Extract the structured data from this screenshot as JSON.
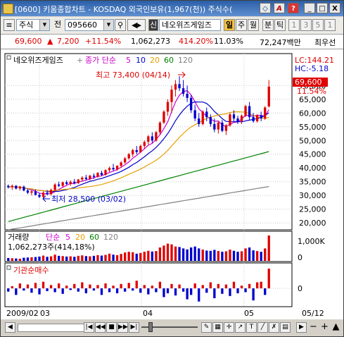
{
  "window": {
    "title": "[0600] 키움종합차트 - KOSDAQ 외국인보유(1,967(천)) 주식수(",
    "buttons": [
      "◇",
      "A",
      "?",
      "_",
      "□",
      "X"
    ]
  },
  "toolbar": {
    "market_type": "주식",
    "prev_label": "전",
    "stock_code": "095660",
    "stock_name": "네오위즈게임즈",
    "period_buttons": [
      "일",
      "주",
      "월",
      "분",
      "틱"
    ],
    "minute_values": [
      "1",
      "3",
      "5",
      "1"
    ]
  },
  "info_row": {
    "price": "69,600",
    "change": "7,200",
    "change_pct": "+11.54%",
    "volume": "1,062,273",
    "volume_ratio": "414.20%",
    "turnover": "11.03%",
    "trade_value": "72,247백만",
    "right_label": "최우선"
  },
  "legend": {
    "stock_name": "네오위즈게임즈",
    "ma_label": "종가 단순",
    "ma_periods": [
      "5",
      "10",
      "20",
      "60",
      "120"
    ],
    "ma_colors": [
      "#cc00cc",
      "#0000cc",
      "#e6a000",
      "#008000",
      "#808080"
    ],
    "lc": "LC:144.21",
    "hc": "HC:-5.18"
  },
  "annotations": {
    "high": "최고 73,400 (04/14)",
    "low": "최저 28,500 (03/02)"
  },
  "price_tag": {
    "price": "69,600",
    "pct": "11.54%"
  },
  "volume_panel": {
    "label": "거래량",
    "ma_label": "단순",
    "ma_periods": [
      "5",
      "20",
      "60",
      "120"
    ],
    "value_text": "1,062,273주(414,18%)",
    "axis": [
      "1,000K",
      "0"
    ]
  },
  "inst_panel": {
    "label": "기관순매수",
    "axis": [
      "0"
    ]
  },
  "x_axis": [
    "2009/02",
    "03",
    "04",
    "05",
    "05/12"
  ],
  "chart_data": {
    "type": "candlestick",
    "price_axis": [
      "70,000",
      "65,000",
      "60,000",
      "55,000",
      "50,000",
      "45,000",
      "40,000",
      "35,000",
      "30,000",
      "25,000",
      "20,000"
    ],
    "ylim": [
      18000,
      77000
    ],
    "candles": [
      [
        33500,
        34000,
        32500,
        33000
      ],
      [
        33000,
        34000,
        32000,
        33500
      ],
      [
        33500,
        33800,
        32200,
        32500
      ],
      [
        32500,
        33500,
        31800,
        33200
      ],
      [
        33200,
        33600,
        31500,
        31800
      ],
      [
        31800,
        32500,
        30500,
        31000
      ],
      [
        31000,
        32000,
        30000,
        31500
      ],
      [
        31500,
        32200,
        30000,
        30200
      ],
      [
        30200,
        31000,
        29000,
        29500
      ],
      [
        29500,
        31500,
        28500,
        31000
      ],
      [
        31000,
        32000,
        30000,
        30500
      ],
      [
        30500,
        32500,
        30000,
        32000
      ],
      [
        32000,
        34500,
        31500,
        34000
      ],
      [
        34000,
        35000,
        33000,
        33500
      ],
      [
        33500,
        35000,
        33000,
        34800
      ],
      [
        34800,
        35500,
        33800,
        34200
      ],
      [
        34200,
        35500,
        33500,
        35000
      ],
      [
        35000,
        36000,
        34000,
        34500
      ],
      [
        34500,
        36000,
        34200,
        35800
      ],
      [
        35800,
        37000,
        35000,
        36500
      ],
      [
        36500,
        37500,
        35500,
        36000
      ],
      [
        36000,
        37500,
        35500,
        37200
      ],
      [
        37200,
        38000,
        36000,
        36800
      ],
      [
        36800,
        38500,
        36500,
        38200
      ],
      [
        38200,
        39000,
        37000,
        37500
      ],
      [
        37500,
        39500,
        37200,
        39200
      ],
      [
        39200,
        40500,
        38500,
        40000
      ],
      [
        40000,
        41500,
        39000,
        39500
      ],
      [
        39500,
        41000,
        39000,
        40800
      ],
      [
        40800,
        42500,
        40000,
        42000
      ],
      [
        42000,
        44000,
        41500,
        43500
      ],
      [
        43500,
        45500,
        43000,
        45000
      ],
      [
        45000,
        47000,
        44000,
        46500
      ],
      [
        46500,
        48000,
        45000,
        45800
      ],
      [
        45800,
        48500,
        45500,
        48000
      ],
      [
        48000,
        50000,
        47000,
        49500
      ],
      [
        49500,
        52000,
        48500,
        51500
      ],
      [
        51500,
        53000,
        49000,
        50000
      ],
      [
        50000,
        53500,
        49500,
        53000
      ],
      [
        53000,
        57000,
        52000,
        56500
      ],
      [
        56500,
        61000,
        56000,
        60500
      ],
      [
        60500,
        65000,
        59000,
        64000
      ],
      [
        64000,
        70000,
        60000,
        68500
      ],
      [
        68500,
        72000,
        66000,
        70500
      ],
      [
        70500,
        73400,
        68000,
        69000
      ],
      [
        69000,
        72000,
        66000,
        67000
      ],
      [
        67000,
        70000,
        64000,
        65500
      ],
      [
        65500,
        66500,
        60000,
        61000
      ],
      [
        61000,
        63000,
        57000,
        58000
      ],
      [
        58000,
        60000,
        55000,
        56000
      ],
      [
        56000,
        61000,
        55500,
        60500
      ],
      [
        60500,
        62000,
        57000,
        58500
      ],
      [
        58500,
        59500,
        55000,
        56000
      ],
      [
        56000,
        58000,
        53000,
        54000
      ],
      [
        54000,
        57000,
        52500,
        56500
      ],
      [
        56500,
        57500,
        53000,
        53500
      ],
      [
        53500,
        56000,
        52000,
        55500
      ],
      [
        55500,
        60000,
        55000,
        59500
      ],
      [
        59500,
        61000,
        57000,
        58000
      ],
      [
        58000,
        59000,
        56000,
        57000
      ],
      [
        57000,
        59500,
        56000,
        59000
      ],
      [
        59000,
        63000,
        58500,
        62500
      ],
      [
        62500,
        64000,
        57500,
        58500
      ],
      [
        58500,
        60000,
        56500,
        57000
      ],
      [
        57000,
        59500,
        56500,
        59200
      ],
      [
        59200,
        60500,
        57000,
        58000
      ],
      [
        58000,
        62500,
        57500,
        62000
      ],
      [
        62400,
        72000,
        62000,
        69600
      ]
    ],
    "volume": [
      120,
      110,
      100,
      90,
      130,
      140,
      150,
      160,
      180,
      220,
      170,
      190,
      260,
      210,
      200,
      180,
      190,
      170,
      210,
      230,
      200,
      190,
      210,
      240,
      220,
      250,
      300,
      260,
      240,
      290,
      350,
      380,
      360,
      300,
      330,
      380,
      420,
      390,
      410,
      560,
      640,
      720,
      690,
      600,
      580,
      520,
      480,
      560,
      600,
      520,
      470,
      430,
      420,
      460,
      410,
      380,
      400,
      470,
      420,
      380,
      400,
      520,
      560,
      440,
      410,
      380,
      520,
      1062
    ],
    "institutional": [
      -30,
      20,
      -60,
      45,
      -20,
      35,
      -40,
      50,
      -55,
      60,
      -25,
      30,
      -35,
      45,
      -50,
      25,
      -15,
      40,
      -30,
      55,
      -45,
      35,
      -20,
      30,
      -60,
      45,
      -35,
      25,
      -45,
      40,
      -30,
      50,
      -20,
      70,
      -40,
      30,
      -55,
      25,
      -35,
      60,
      -80,
      -45,
      40,
      -65,
      35,
      -30,
      -100,
      -60,
      45,
      -120,
      30,
      -40,
      55,
      -90,
      40,
      -50,
      35,
      -70,
      60,
      -45,
      25,
      -35,
      40,
      -110,
      55,
      60,
      -60,
      180
    ]
  }
}
